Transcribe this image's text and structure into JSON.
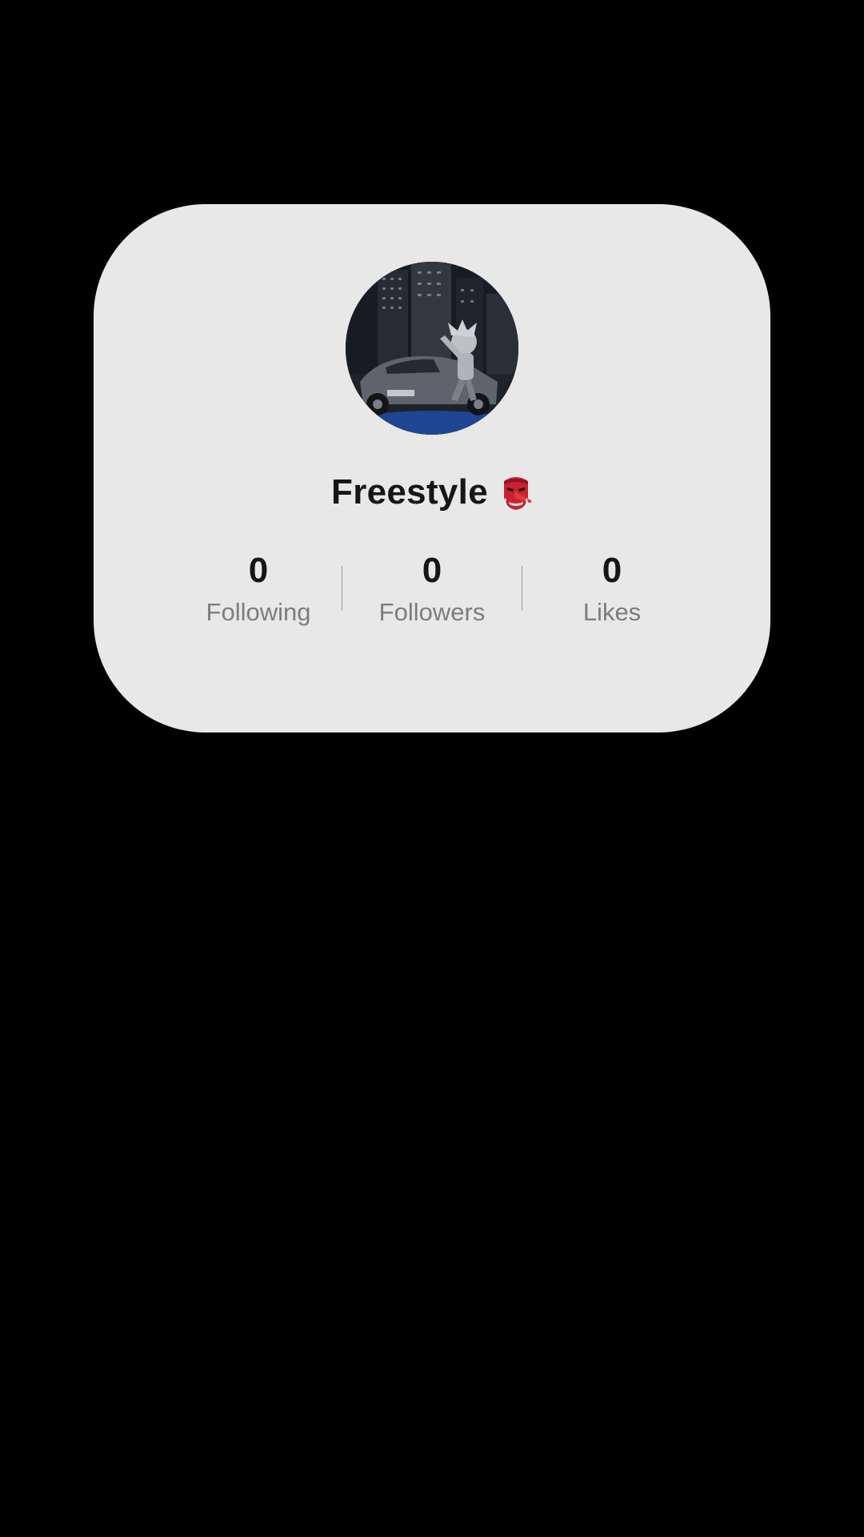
{
  "profile": {
    "display_name": "Freestyle",
    "name_emoji_icon": "tengu-mask-icon",
    "avatar_icon": "avatar-night-city-car"
  },
  "stats": [
    {
      "value": "0",
      "label": "Following"
    },
    {
      "value": "0",
      "label": "Followers"
    },
    {
      "value": "0",
      "label": "Likes"
    }
  ],
  "colors": {
    "background": "#000000",
    "card": "#e8e8e8",
    "primary_text": "#161616",
    "secondary_text": "#7d7d7d"
  }
}
